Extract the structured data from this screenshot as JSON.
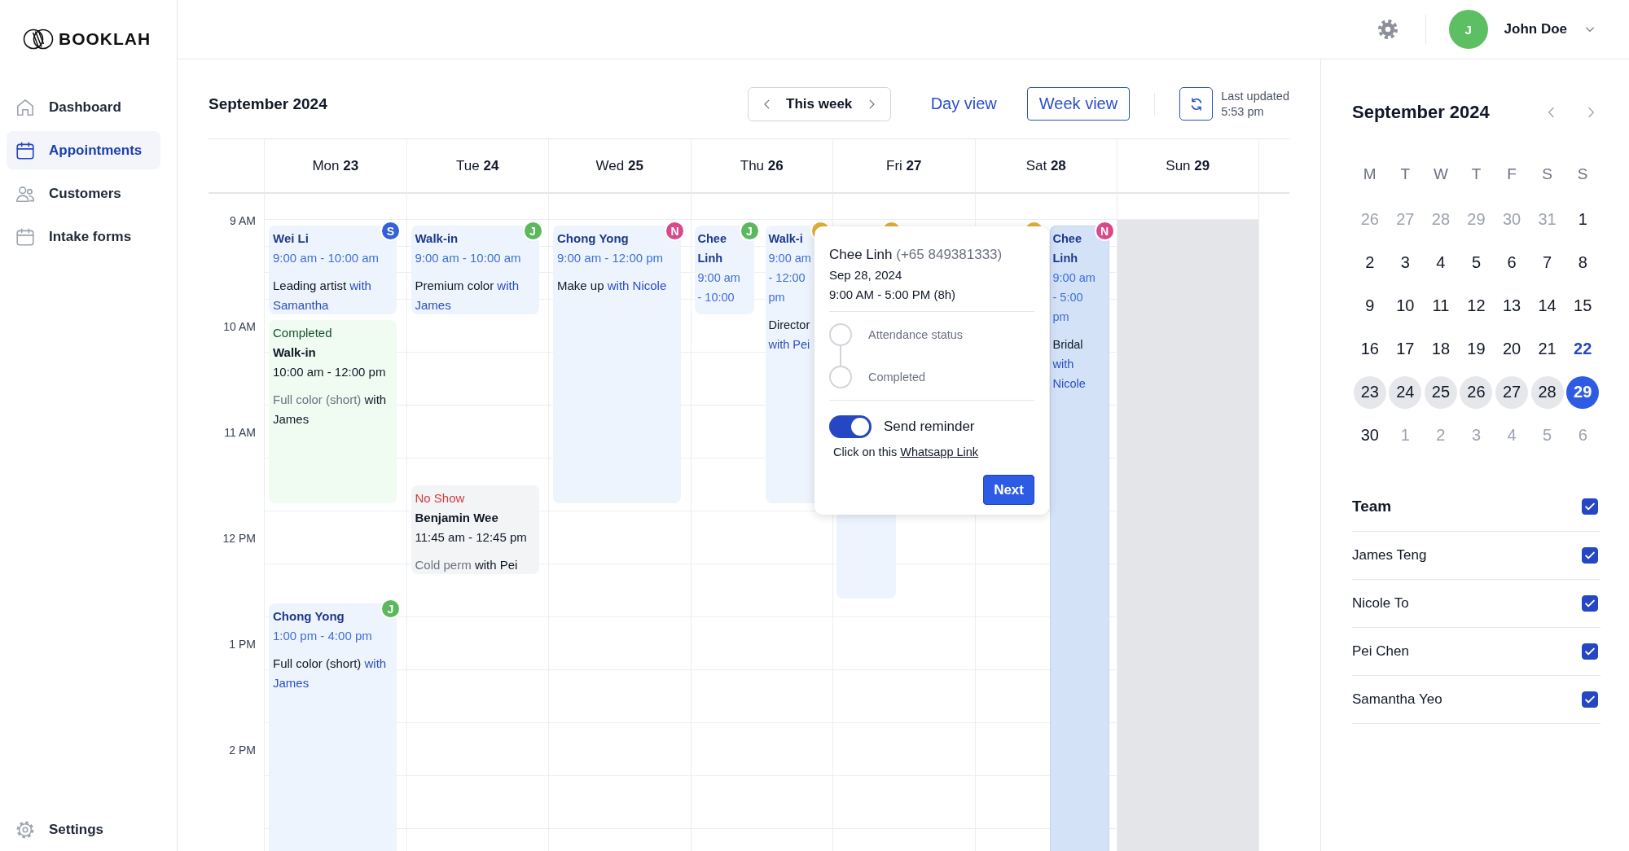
{
  "brand": {
    "name": "BOOKLAH"
  },
  "nav": [
    {
      "label": "Dashboard",
      "kind": "home",
      "selected": false
    },
    {
      "label": "Appointments",
      "kind": "calendar",
      "selected": true
    },
    {
      "label": "Customers",
      "kind": "people",
      "selected": false
    },
    {
      "label": "Intake forms",
      "kind": "calendar",
      "selected": false
    }
  ],
  "settings_link": {
    "label": "Settings"
  },
  "user": {
    "initial": "J",
    "name": "John Doe"
  },
  "toolbar": {
    "title": "September 2024",
    "range": "This week",
    "views": [
      {
        "label": "Day view",
        "selected": false
      },
      {
        "label": "Week view",
        "selected": true
      }
    ],
    "last_updated": "Last updated",
    "updated_time": "5:53 pm"
  },
  "time_labels": [
    "9 AM",
    "10 AM",
    "11 AM",
    "12 PM",
    "1 PM",
    "2 PM"
  ],
  "days": [
    {
      "label": "Mon **23**",
      "unavailable": false,
      "events": [
        {
          "kind": "booked",
          "selected": false,
          "title": "Wei Li",
          "time": "9:00 am - 10:00 am",
          "service": "Leading artist",
          "staff": "with Samantha",
          "avatar": {
            "letter": "S",
            "color": "#3460d8"
          }
        },
        {
          "kind": "completed",
          "selected": false,
          "status": "Completed",
          "title": "Walk-in",
          "time": "10:00 am - 12:00 pm",
          "service": "Full color (short)",
          "staff": "with James"
        },
        {
          "kind": "booked",
          "selected": false,
          "title": "Chong Yong",
          "time": "1:00 pm - 4:00 pm",
          "service": "Full color (short)",
          "staff": "with James",
          "avatar": {
            "letter": "J",
            "color": "#5cb85c"
          }
        }
      ]
    },
    {
      "label": "Tue **24**",
      "unavailable": false,
      "events": [
        {
          "kind": "booked",
          "selected": false,
          "title": "Walk-in",
          "time": "9:00 am - 10:00 am",
          "service": "Premium color",
          "staff": "with James",
          "avatar": {
            "letter": "J",
            "color": "#5cb85c"
          }
        },
        {
          "kind": "no-show",
          "selected": false,
          "status": "No Show",
          "title": "Benjamin Wee",
          "time": "11:45 am - 12:45 pm",
          "service": "Cold perm",
          "staff": "with Pei"
        }
      ]
    },
    {
      "label": "Wed **25**",
      "unavailable": false,
      "events": [
        {
          "kind": "booked",
          "selected": false,
          "title": "Chong Yong",
          "time": "9:00 am - 12:00 pm",
          "service": "Make up",
          "staff": "with Nicole",
          "avatar": {
            "letter": "N",
            "color": "#d9488a"
          }
        }
      ]
    },
    {
      "label": "Thu **26**",
      "unavailable": false,
      "events": [
        {
          "kind": "booked",
          "selected": false,
          "title": "Chee Linh",
          "time": "9:00 am - 10:00",
          "avatar": {
            "letter": "J",
            "color": "#5cb85c"
          }
        },
        {
          "kind": "booked",
          "selected": false,
          "title": "Walk-i",
          "time": "9:00 am - 12:00 pm",
          "service": "Director",
          "staff": "with Pei",
          "avatar": {
            "color": "#dfae3a"
          }
        }
      ]
    },
    {
      "label": "Fri **27**",
      "unavailable": false,
      "events": [
        {
          "kind": "covered-long",
          "avatar": {
            "color": "#dfae3a"
          }
        }
      ]
    },
    {
      "label": "Sat **28**",
      "unavailable": false,
      "events": [
        {
          "kind": "covered",
          "avatar": {
            "color": "#dfae3a"
          }
        },
        {
          "kind": "booked",
          "selected": true,
          "title": "Chee Linh",
          "time": "9:00 am - 5:00 pm",
          "service": "Bridal",
          "staff": "with Nicole",
          "avatar": {
            "letter": "N",
            "color": "#d9488a"
          }
        }
      ]
    },
    {
      "label": "Sun **29**",
      "unavailable": true
    }
  ],
  "popup": {
    "name": "Chee Linh",
    "phone": "(+65 849381333)",
    "date": "Sep 28, 2024",
    "time": "9:00 AM - 5:00 PM (8h)",
    "steps": [
      {
        "label": "Attendance status",
        "done": false
      },
      {
        "label": "Completed",
        "done": false
      }
    ],
    "reminder": {
      "label": "Send reminder",
      "on": true
    },
    "link_intro": "Click on this",
    "link": "Whatsapp Link",
    "button": "Next"
  },
  "mini_calendar": {
    "title": "September 2024",
    "weekdays": [
      "M",
      "T",
      "W",
      "T",
      "F",
      "S",
      "S"
    ],
    "dates": [
      {
        "label": "26",
        "outside": true,
        "today": false,
        "in_week": false,
        "selected": false
      },
      {
        "label": "27",
        "outside": true,
        "today": false,
        "in_week": false,
        "selected": false
      },
      {
        "label": "28",
        "outside": true,
        "today": false,
        "in_week": false,
        "selected": false
      },
      {
        "label": "29",
        "outside": true,
        "today": false,
        "in_week": false,
        "selected": false
      },
      {
        "label": "30",
        "outside": true,
        "today": false,
        "in_week": false,
        "selected": false
      },
      {
        "label": "31",
        "outside": true,
        "today": false,
        "in_week": false,
        "selected": false
      },
      {
        "label": "1",
        "outside": false,
        "today": false,
        "in_week": false,
        "selected": false
      },
      {
        "label": "2",
        "outside": false,
        "today": false,
        "in_week": false,
        "selected": false
      },
      {
        "label": "3",
        "outside": false,
        "today": false,
        "in_week": false,
        "selected": false
      },
      {
        "label": "4",
        "outside": false,
        "today": false,
        "in_week": false,
        "selected": false
      },
      {
        "label": "5",
        "outside": false,
        "today": false,
        "in_week": false,
        "selected": false
      },
      {
        "label": "6",
        "outside": false,
        "today": false,
        "in_week": false,
        "selected": false
      },
      {
        "label": "7",
        "outside": false,
        "today": false,
        "in_week": false,
        "selected": false
      },
      {
        "label": "8",
        "outside": false,
        "today": false,
        "in_week": false,
        "selected": false
      },
      {
        "label": "9",
        "outside": false,
        "today": false,
        "in_week": false,
        "selected": false
      },
      {
        "label": "10",
        "outside": false,
        "today": false,
        "in_week": false,
        "selected": false
      },
      {
        "label": "11",
        "outside": false,
        "today": false,
        "in_week": false,
        "selected": false
      },
      {
        "label": "12",
        "outside": false,
        "today": false,
        "in_week": false,
        "selected": false
      },
      {
        "label": "13",
        "outside": false,
        "today": false,
        "in_week": false,
        "selected": false
      },
      {
        "label": "14",
        "outside": false,
        "today": false,
        "in_week": false,
        "selected": false
      },
      {
        "label": "15",
        "outside": false,
        "today": false,
        "in_week": false,
        "selected": false
      },
      {
        "label": "16",
        "outside": false,
        "today": false,
        "in_week": false,
        "selected": false
      },
      {
        "label": "17",
        "outside": false,
        "today": false,
        "in_week": false,
        "selected": false
      },
      {
        "label": "18",
        "outside": false,
        "today": false,
        "in_week": false,
        "selected": false
      },
      {
        "label": "19",
        "outside": false,
        "today": false,
        "in_week": false,
        "selected": false
      },
      {
        "label": "20",
        "outside": false,
        "today": false,
        "in_week": false,
        "selected": false
      },
      {
        "label": "21",
        "outside": false,
        "today": false,
        "in_week": false,
        "selected": false
      },
      {
        "label": "22",
        "outside": false,
        "today": true,
        "in_week": false,
        "selected": false
      },
      {
        "label": "23",
        "outside": false,
        "today": false,
        "in_week": true,
        "selected": false
      },
      {
        "label": "24",
        "outside": false,
        "today": false,
        "in_week": true,
        "selected": false
      },
      {
        "label": "25",
        "outside": false,
        "today": false,
        "in_week": true,
        "selected": false
      },
      {
        "label": "26",
        "outside": false,
        "today": false,
        "in_week": true,
        "selected": false
      },
      {
        "label": "27",
        "outside": false,
        "today": false,
        "in_week": true,
        "selected": false
      },
      {
        "label": "28",
        "outside": false,
        "today": false,
        "in_week": true,
        "selected": false
      },
      {
        "label": "29",
        "outside": false,
        "today": false,
        "in_week": true,
        "selected": true
      },
      {
        "label": "30",
        "outside": false,
        "today": false,
        "in_week": false,
        "selected": false
      },
      {
        "label": "1",
        "outside": true,
        "today": false,
        "in_week": false,
        "selected": false
      },
      {
        "label": "2",
        "outside": true,
        "today": false,
        "in_week": false,
        "selected": false
      },
      {
        "label": "3",
        "outside": true,
        "today": false,
        "in_week": false,
        "selected": false
      },
      {
        "label": "4",
        "outside": true,
        "today": false,
        "in_week": false,
        "selected": false
      },
      {
        "label": "5",
        "outside": true,
        "today": false,
        "in_week": false,
        "selected": false
      },
      {
        "label": "6",
        "outside": true,
        "today": false,
        "in_week": false,
        "selected": false
      }
    ]
  },
  "team": {
    "title": "Team",
    "checked": true,
    "members": [
      {
        "name": "James Teng",
        "checked": true
      },
      {
        "name": "Nicole To",
        "checked": true
      },
      {
        "name": "Pei Chen",
        "checked": true
      },
      {
        "name": "Samantha Yeo",
        "checked": true
      }
    ]
  }
}
